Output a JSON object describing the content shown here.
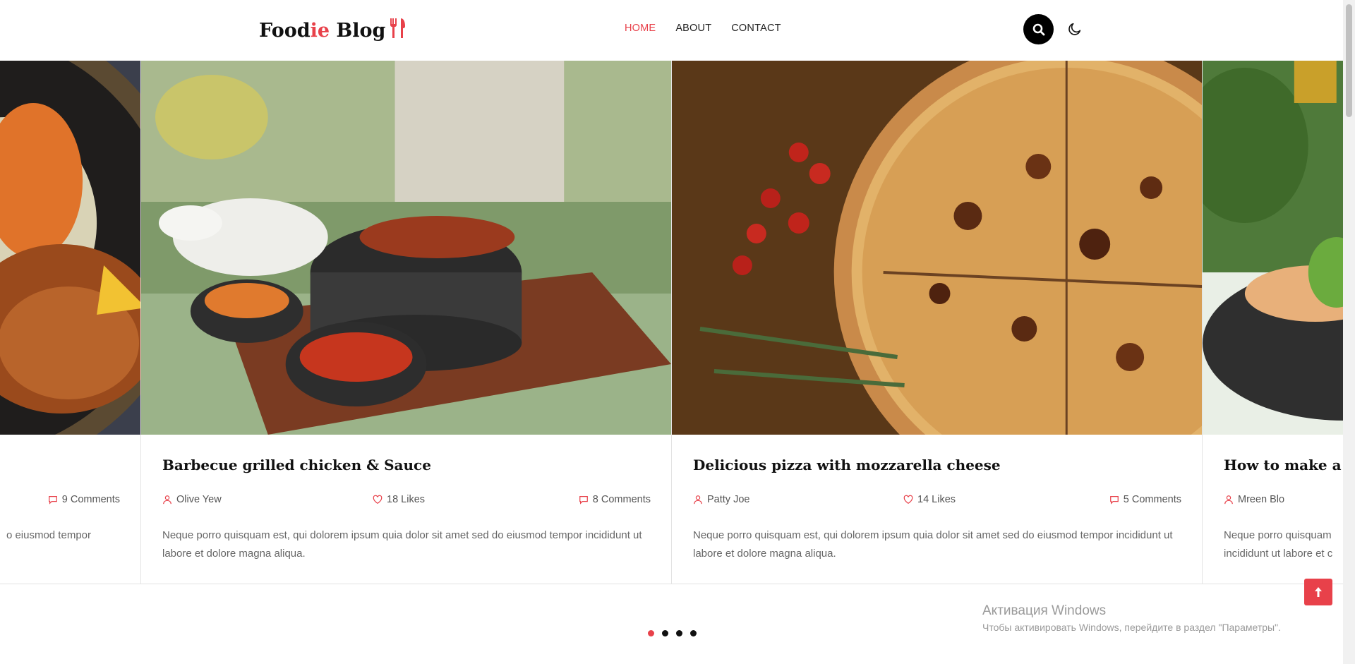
{
  "header": {
    "logo_main": "Food",
    "logo_accent": "ie",
    "logo_rest": " Blog",
    "nav": [
      {
        "label": "HOME",
        "active": true
      },
      {
        "label": "ABOUT",
        "active": false
      },
      {
        "label": "CONTACT",
        "active": false
      }
    ]
  },
  "slider": {
    "cards": [
      {
        "title": "",
        "author": "",
        "likes": "",
        "comments": "9 Comments",
        "excerpt": "o eiusmod tempor"
      },
      {
        "title": "Barbecue grilled chicken & Sauce",
        "author": "Olive Yew",
        "likes": "18 Likes",
        "comments": "8 Comments",
        "excerpt": "Neque porro quisquam est, qui dolorem ipsum quia dolor sit amet sed do eiusmod tempor incididunt ut labore et dolore magna aliqua."
      },
      {
        "title": "Delicious pizza with mozzarella cheese",
        "author": "Patty Joe",
        "likes": "14 Likes",
        "comments": "5 Comments",
        "excerpt": "Neque porro quisquam est, qui dolorem ipsum quia dolor sit amet sed do eiusmod tempor incididunt ut labore et dolore magna aliqua."
      },
      {
        "title": "How to make a qu",
        "author": "Mreen Blo",
        "likes": "",
        "comments": "",
        "excerpt": "Neque porro quisquam incididunt ut labore et c"
      }
    ],
    "dots": 4,
    "active_dot": 0
  },
  "watermark": {
    "line1": "Активация Windows",
    "line2": "Чтобы активировать Windows, перейдите в раздел \"Параметры\"."
  },
  "colors": {
    "accent": "#e8414a",
    "text": "#222222",
    "muted": "#666666"
  }
}
